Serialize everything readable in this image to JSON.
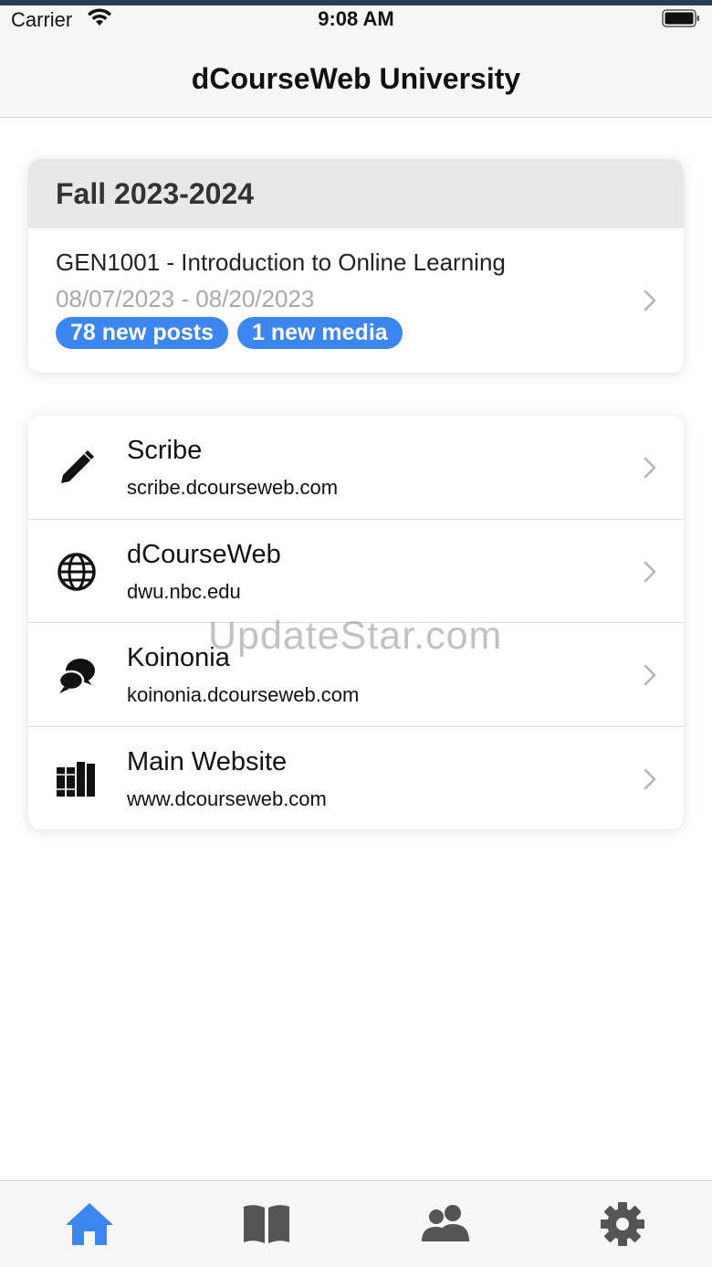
{
  "status_bar": {
    "carrier": "Carrier",
    "time": "9:08 AM"
  },
  "nav": {
    "title": "dCourseWeb University"
  },
  "term": {
    "title": "Fall 2023-2024",
    "course": {
      "name": "GEN1001 - Introduction to Online Learning",
      "dates": "08/07/2023 - 08/20/2023",
      "badges": [
        "78 new posts",
        "1 new media"
      ]
    }
  },
  "links": [
    {
      "title": "Scribe",
      "url": "scribe.dcourseweb.com",
      "icon": "pencil-icon"
    },
    {
      "title": "dCourseWeb",
      "url": "dwu.nbc.edu",
      "icon": "globe-icon"
    },
    {
      "title": "Koinonia",
      "url": "koinonia.dcourseweb.com",
      "icon": "chat-bubbles-icon"
    },
    {
      "title": "Main Website",
      "url": "www.dcourseweb.com",
      "icon": "books-icon"
    }
  ],
  "watermark": "UpdateStar.com",
  "tabs": [
    {
      "icon": "home-icon",
      "active": true
    },
    {
      "icon": "book-icon",
      "active": false
    },
    {
      "icon": "people-icon",
      "active": false
    },
    {
      "icon": "gear-icon",
      "active": false
    }
  ],
  "colors": {
    "accent": "#3b86f0",
    "tab_inactive": "#555555"
  }
}
